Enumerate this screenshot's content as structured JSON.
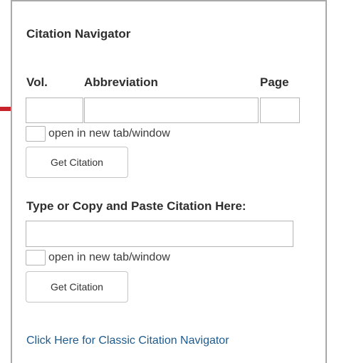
{
  "panel": {
    "title": "Citation Navigator"
  },
  "citation_form": {
    "columns": {
      "vol": "Vol.",
      "abbreviation": "Abbreviation",
      "page": "Page"
    },
    "vol_value": "",
    "abbreviation_value": "",
    "page_value": "",
    "open_new_tab_label": "open in new tab/window",
    "open_new_tab_checked": false,
    "submit_label": "Get Citation"
  },
  "paste_form": {
    "label": "Type or Copy and Paste Citation Here:",
    "value": "",
    "open_new_tab_label": "open in new tab/window",
    "open_new_tab_checked": false,
    "submit_label": "Get Citation"
  },
  "footer": {
    "classic_link_label": "Click Here for Classic Citation Navigator"
  },
  "icons": {
    "pointer": "arrow-right-icon"
  },
  "colors": {
    "panel_border": "#a9a9a9",
    "link": "#1f5a8c",
    "arrow": "#c8232b",
    "input_border": "#b4b4b4"
  }
}
